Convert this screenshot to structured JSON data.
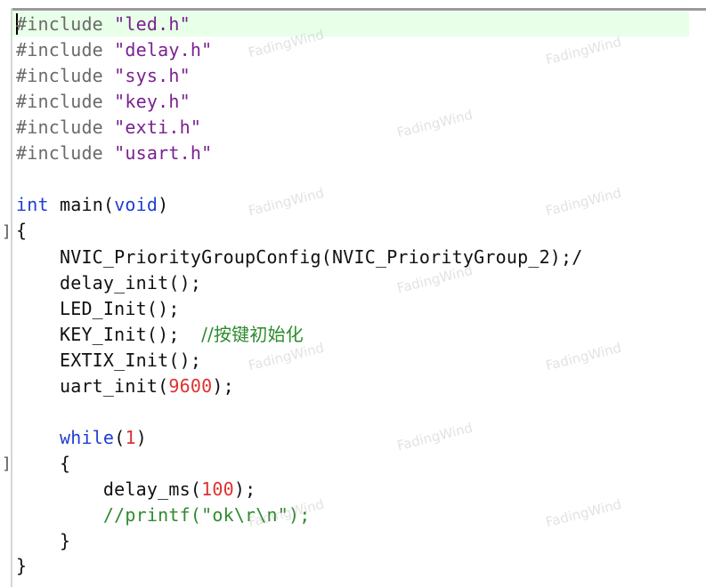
{
  "editor": {
    "lines": [
      {
        "pp": "#include ",
        "str": "\"led.h\""
      },
      {
        "pp": "#include ",
        "str": "\"delay.h\""
      },
      {
        "pp": "#include ",
        "str": "\"sys.h\""
      },
      {
        "pp": "#include ",
        "str": "\"key.h\""
      },
      {
        "pp": "#include ",
        "str": "\"exti.h\""
      },
      {
        "pp": "#include ",
        "str": "\"usart.h\""
      },
      {
        "kw1": "int",
        "mid": " main(",
        "kw2": "void",
        "end": ")"
      },
      {
        "text": "{"
      },
      {
        "text": "    NVIC_PriorityGroupConfig(NVIC_PriorityGroup_2);/"
      },
      {
        "text": "    delay_init();"
      },
      {
        "text": "    LED_Init();"
      },
      {
        "code": "    KEY_Init();  ",
        "cmt": "//按键初始化"
      },
      {
        "text": "    EXTIX_Init();"
      },
      {
        "pre": "    uart_init(",
        "num": "9600",
        "post": ");"
      },
      {
        "kw": "while",
        "open": "(",
        "num": "1",
        "close": ")"
      },
      {
        "text": "    {"
      },
      {
        "pre": "        delay_ms(",
        "num": "100",
        "post": ");"
      },
      {
        "cmt": "        //printf(\"ok\\r\\n\");"
      },
      {
        "text": "    }"
      },
      {
        "text": "}"
      }
    ],
    "fold_markers": [
      "]",
      "]"
    ]
  },
  "watermark": {
    "text": "FadingWind"
  }
}
